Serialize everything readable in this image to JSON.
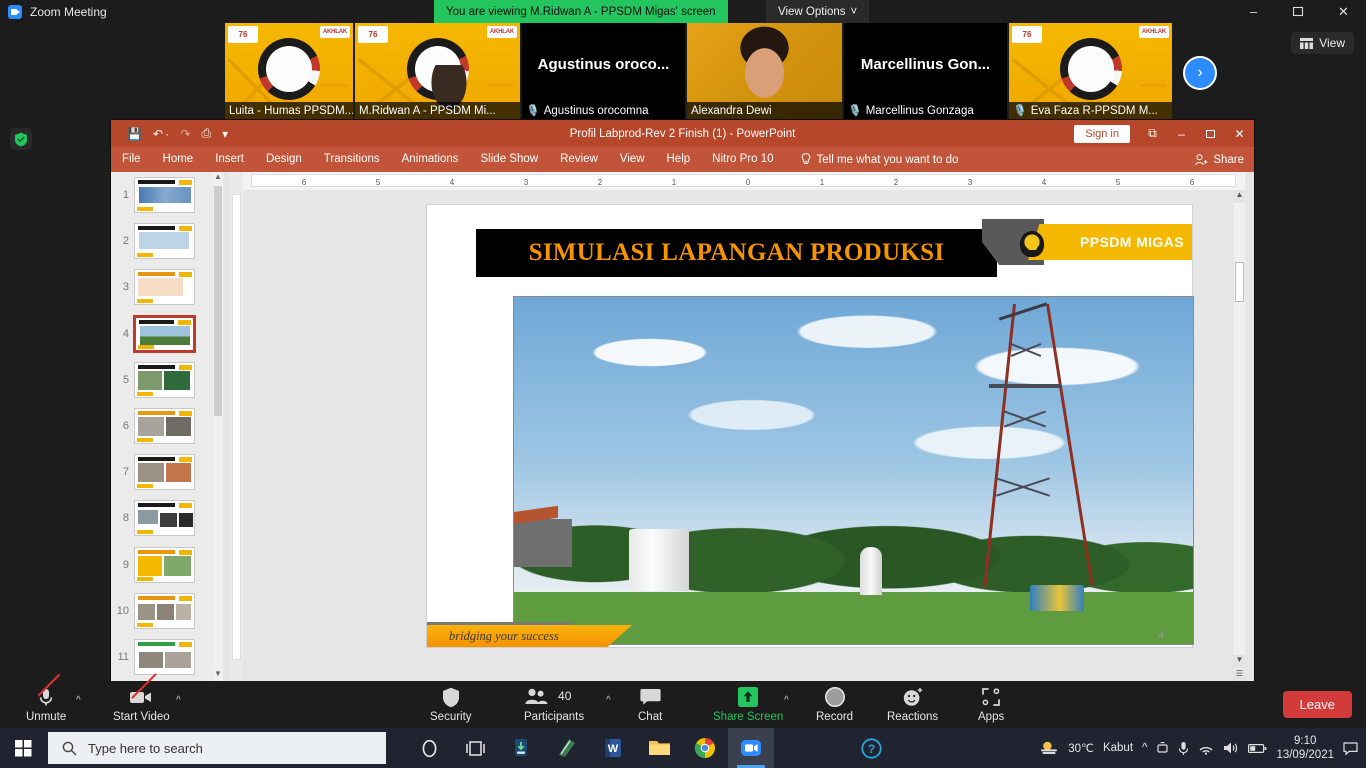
{
  "zoom_window": {
    "app_title": "Zoom Meeting",
    "viewing_banner": "You are viewing M.Ridwan A - PPSDM Migas' screen",
    "view_options_label": "View Options",
    "view_options_caret": "˅",
    "window_controls": {
      "minimize": "–",
      "maximize": "❐",
      "close": "✕"
    },
    "view_chip_label": "View",
    "next_arrow": "›"
  },
  "participants_strip": [
    {
      "name": "Luita - Humas PPSDM...",
      "muted": false,
      "kind": "avatar-card",
      "active": false
    },
    {
      "name": "M.Ridwan A - PPSDM Mi...",
      "muted": false,
      "kind": "avatar-card-person",
      "active": true
    },
    {
      "name": "Agustinus orocomna",
      "display_name": "Agustinus  oroco...",
      "muted": true,
      "kind": "name-only",
      "active": false
    },
    {
      "name": "Alexandra Dewi",
      "muted": false,
      "kind": "video-face",
      "active": false
    },
    {
      "name": "Marcellinus Gonzaga",
      "display_name": "Marcellinus  Gon...",
      "muted": true,
      "kind": "name-only",
      "active": false
    },
    {
      "name": "Eva Faza R-PPSDM M...",
      "muted": true,
      "kind": "avatar-card",
      "active": false
    }
  ],
  "powerpoint": {
    "document_title": "Profil Labprod-Rev 2 Finish (1)  -  PowerPoint",
    "sign_in_label": "Sign in",
    "quick_access": [
      "save-icon",
      "undo-icon",
      "redo-icon",
      "present-icon",
      "customize-icon"
    ],
    "ribbon_tabs": [
      "File",
      "Home",
      "Insert",
      "Design",
      "Transitions",
      "Animations",
      "Slide Show",
      "Review",
      "View",
      "Help",
      "Nitro Pro 10"
    ],
    "tell_me": "Tell me what you want to do",
    "share_label": "Share",
    "window_controls": {
      "ribbon_options": "⧉",
      "minimize": "–",
      "restore": "❐",
      "close": "✕"
    },
    "ruler_ticks": [
      "6",
      "5",
      "4",
      "3",
      "2",
      "1",
      "0",
      "1",
      "2",
      "3",
      "4",
      "5",
      "6"
    ],
    "slide_panel": {
      "slides": [
        {
          "number": "1",
          "selected": false
        },
        {
          "number": "2",
          "selected": false
        },
        {
          "number": "3",
          "selected": false
        },
        {
          "number": "4",
          "selected": true
        },
        {
          "number": "5",
          "selected": false
        },
        {
          "number": "6",
          "selected": false
        },
        {
          "number": "7",
          "selected": false
        },
        {
          "number": "8",
          "selected": false
        },
        {
          "number": "9",
          "selected": false
        },
        {
          "number": "10",
          "selected": false
        },
        {
          "number": "11",
          "selected": false
        }
      ]
    },
    "current_slide": {
      "title": "SIMULASI LAPANGAN PRODUKSI",
      "brand": "PPSDM MIGAS",
      "footer_tagline": "bridging your success",
      "slide_number": "4",
      "photo_alt": "oil field production simulation site with drilling derrick, storage tank and separator"
    }
  },
  "zoom_toolbar": {
    "items": [
      {
        "label": "Unmute",
        "icon": "microphone-muted-icon",
        "has_caret": true
      },
      {
        "label": "Start Video",
        "icon": "video-off-icon",
        "has_caret": true
      },
      {
        "label": "Security",
        "icon": "shield-icon",
        "has_caret": false
      },
      {
        "label": "Participants",
        "icon": "participants-icon",
        "has_caret": true,
        "count": "40"
      },
      {
        "label": "Chat",
        "icon": "chat-bubble-icon",
        "has_caret": false
      },
      {
        "label": "Share Screen",
        "icon": "share-screen-icon",
        "has_caret": true,
        "active": true
      },
      {
        "label": "Record",
        "icon": "record-icon",
        "has_caret": false
      },
      {
        "label": "Reactions",
        "icon": "reactions-icon",
        "has_caret": false
      },
      {
        "label": "Apps",
        "icon": "apps-icon",
        "has_caret": false
      }
    ],
    "leave_label": "Leave",
    "active_color": "#22c55e",
    "leave_color": "#d33b3b"
  },
  "taskbar": {
    "search_placeholder": "Type here to search",
    "pinned": [
      "cortana-icon",
      "task-view-icon",
      "store-icon",
      "mail-icon",
      "word-icon",
      "file-explorer-icon",
      "chrome-icon",
      "zoom-icon"
    ],
    "help_icon": "help-icon",
    "weather": {
      "temperature": "30℃",
      "condition": "Kabut",
      "icon": "fog-sun-icon"
    },
    "tray_icons": [
      "chevron-up-icon",
      "camera-icon",
      "microphone-icon",
      "wifi-icon",
      "volume-icon",
      "battery-icon"
    ],
    "clock": {
      "time": "9:10",
      "date": "13/09/2021"
    },
    "action_center": "notification-icon"
  }
}
